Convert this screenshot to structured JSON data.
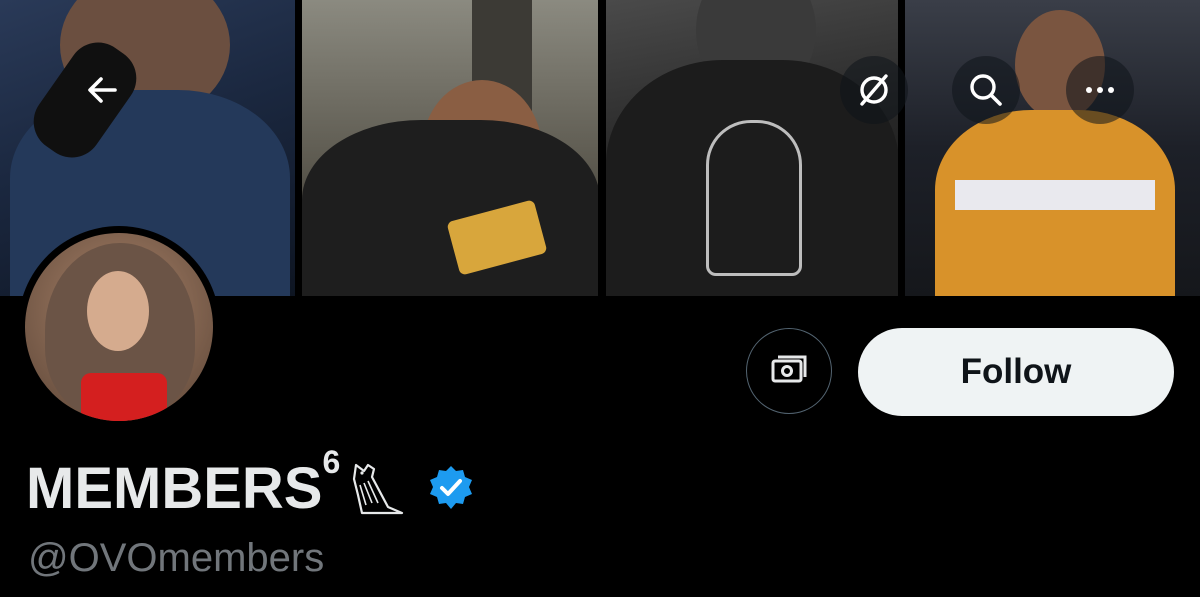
{
  "header": {
    "back_icon": "arrow-left-icon",
    "grok_icon": "grok-icon",
    "search_icon": "search-icon",
    "more_icon": "more-horizontal-icon"
  },
  "banner": {
    "panels": [
      "concert-performer-photo",
      "man-eating-burger-photo",
      "hoodie-owl-logo-photo",
      "jersey-chain-photo"
    ]
  },
  "profile": {
    "display_name": "MEMBERS",
    "display_name_sup": "6",
    "owl_icon": "owl-icon",
    "verified_icon": "verified-badge-icon",
    "verified_color": "#1d9bf0",
    "handle": "@OVOmembers"
  },
  "actions": {
    "tip_icon": "money-icon",
    "follow_label": "Follow"
  },
  "colors": {
    "background": "#000000",
    "text_primary": "#e7e9ea",
    "text_secondary": "#71767b",
    "follow_bg": "#eff3f4"
  }
}
